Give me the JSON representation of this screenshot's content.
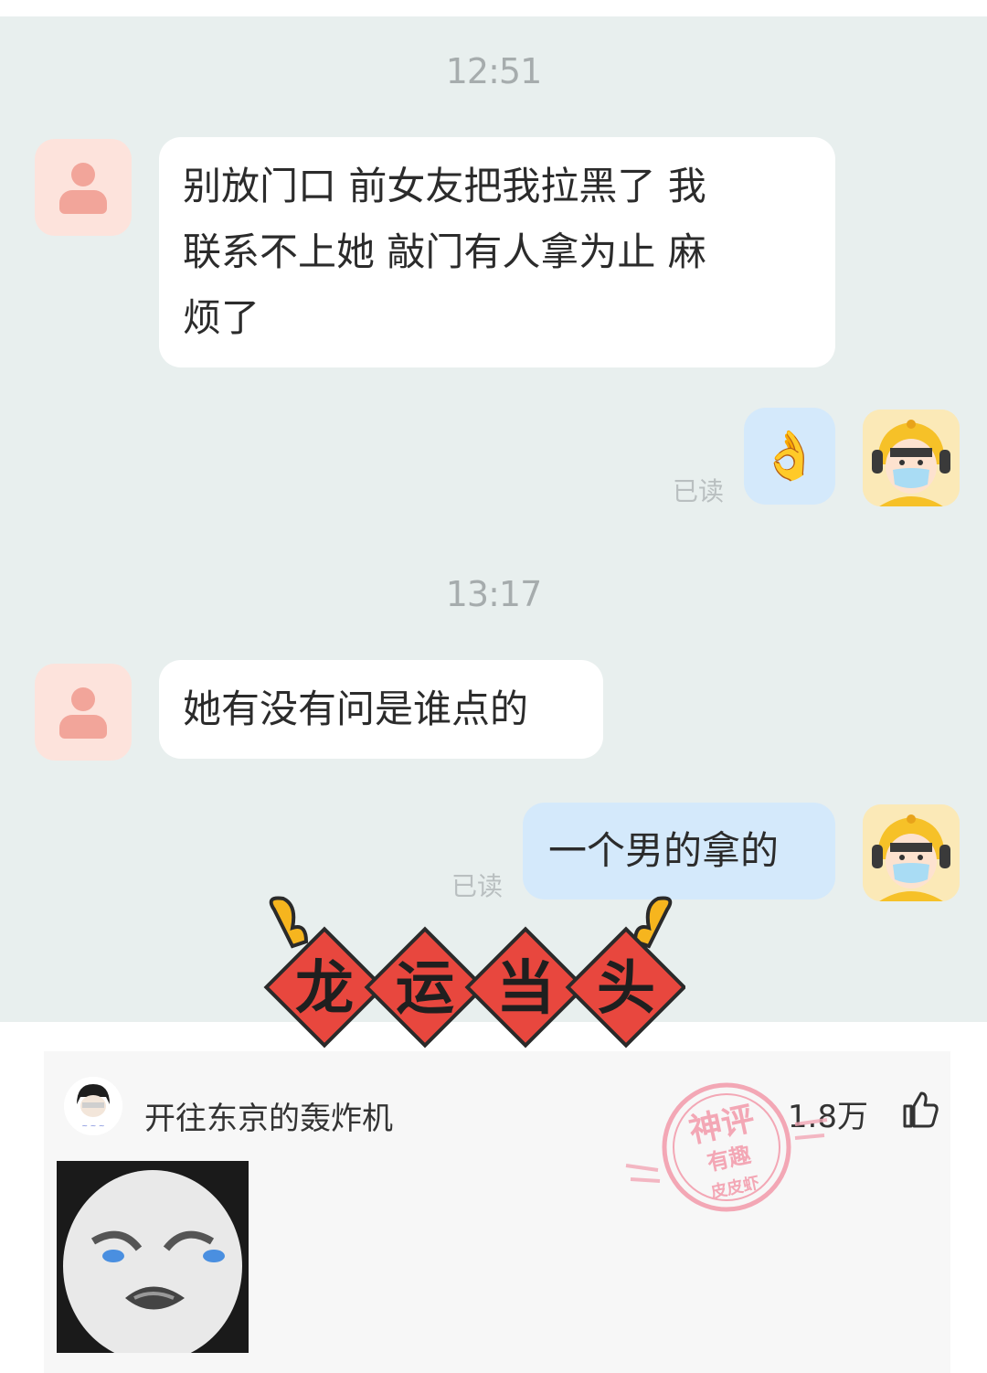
{
  "messages": [
    {
      "time": "12:51"
    },
    {
      "left_text_lines": [
        "别放门口  前女友把我拉黑了   我",
        "联系不上她  敲门有人拿为止   麻",
        "烦了"
      ]
    },
    {
      "right_emoji": "👌",
      "read_label": "已读"
    },
    {
      "time": "13:17"
    },
    {
      "left_text": "她有没有问是谁点的"
    },
    {
      "right_text": "一个男的拿的",
      "read_label": "已读"
    }
  ],
  "banner": {
    "text": [
      "龙",
      "运",
      "当",
      "头"
    ]
  },
  "comment": {
    "username": "开往东京的轰炸机",
    "likes": "1.8万"
  },
  "stamp": {
    "line1": "神评",
    "line2": "有趣",
    "line3": "皮皮虾"
  },
  "colors": {
    "chat_bg": "#e8efee",
    "bubble_right": "#d4e9fb",
    "banner_red": "#e8473e",
    "stamp_pink": "#f3a7b5"
  },
  "icons": [
    "user-avatar-icon",
    "ok-hand-icon",
    "delivery-rider-avatar-icon",
    "thumbs-up-icon"
  ]
}
